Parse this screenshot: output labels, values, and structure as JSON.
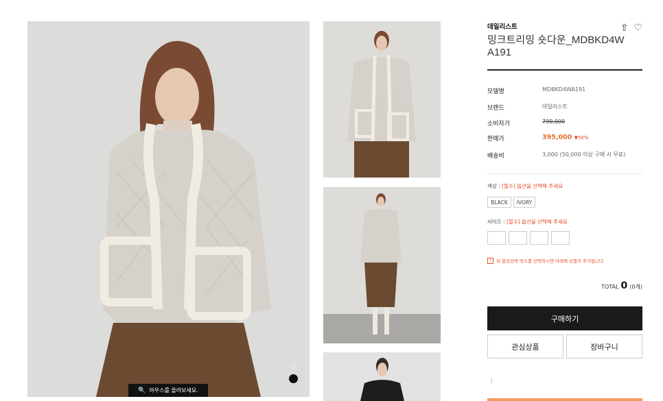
{
  "gallery": {
    "zoom_hint": "마우스를 올려보세요.",
    "zoom_icon": "search-icon"
  },
  "product": {
    "brand": "데일리스트",
    "title": "밍크트리밍 숏다운_MDBKD4WA191",
    "specs": {
      "model_label": "모델명",
      "model_value": "MDBKD4WA191",
      "brand_label": "브랜드",
      "brand_value": "데일리스트",
      "retail_label": "소비자가",
      "retail_value": "790,000",
      "sale_label": "판매가",
      "sale_value": "395,000",
      "discount": "50%",
      "shipping_label": "배송비",
      "shipping_value": "3,000 (50,000 이상 구매 시 무료)"
    },
    "color": {
      "label": "색상 : ",
      "required": "[필수] 옵션을 선택해 주세요",
      "options": [
        "BLACK",
        "IVORY"
      ]
    },
    "size": {
      "label": "사이즈 : ",
      "required": "[필수] 옵션을 선택해 주세요"
    },
    "notice_icon": "!",
    "notice": "위 옵션선택 박스를 선택하시면 아래에 상품이 추가됩니다.",
    "total": {
      "label": "TOTAL",
      "value": "0",
      "count": "(0개)"
    },
    "buttons": {
      "buy": "구매하기",
      "wishlist": "관심상품",
      "cart": "장바구니"
    }
  },
  "colors": {
    "accent_orange": "#e8702a",
    "required_red": "#e84a2a",
    "buy_button": "#1a1a1a"
  }
}
